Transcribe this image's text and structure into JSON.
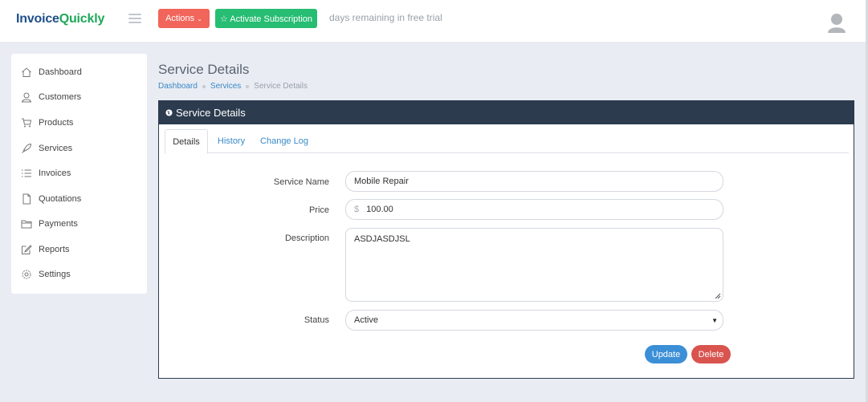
{
  "app": {
    "logo_part1": "Invoice",
    "logo_part2": "Quickly",
    "brand_blue": "#1e4f8a",
    "brand_green": "#1ea85a"
  },
  "topbar": {
    "actions_label": "Actions",
    "activate_label": "Activate Subscription",
    "trial_text": "days remaining in free trial",
    "actions_color": "#f1655a",
    "activate_color": "#27bd73"
  },
  "sidebar": {
    "items": [
      {
        "label": "Dashboard",
        "icon": "home-icon"
      },
      {
        "label": "Customers",
        "icon": "user-icon"
      },
      {
        "label": "Products",
        "icon": "cart-icon"
      },
      {
        "label": "Services",
        "icon": "rocket-icon"
      },
      {
        "label": "Invoices",
        "icon": "list-icon"
      },
      {
        "label": "Quotations",
        "icon": "document-icon"
      },
      {
        "label": "Payments",
        "icon": "folder-icon"
      },
      {
        "label": "Reports",
        "icon": "edit-icon"
      },
      {
        "label": "Settings",
        "icon": "gear-icon"
      }
    ]
  },
  "main": {
    "title": "Service Details",
    "breadcrumb": [
      "Dashboard",
      "Services",
      "Service Details"
    ],
    "card_title": "Service Details",
    "header_color": "#2c3b4e",
    "tabs": [
      {
        "label": "Details",
        "active": true
      },
      {
        "label": "History",
        "active": false
      },
      {
        "label": "Change Log",
        "active": false
      }
    ],
    "form": {
      "service_name_label": "Service Name",
      "service_name_value": "Mobile Repair",
      "price_label": "Price",
      "price_prefix": "$",
      "price_value": "100.00",
      "description_label": "Description",
      "description_value": "ASDJASDJSL",
      "status_label": "Status",
      "status_value": "Active"
    },
    "update_label": "Update",
    "delete_label": "Delete",
    "update_color": "#3b8fd6",
    "delete_color": "#d9534f"
  }
}
